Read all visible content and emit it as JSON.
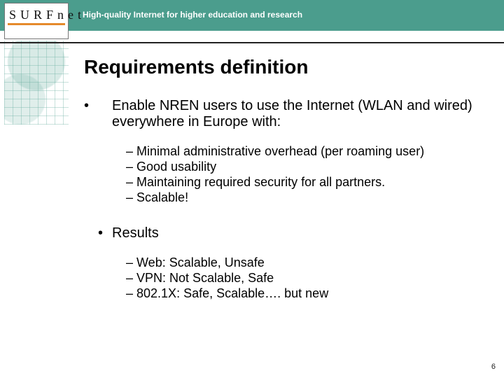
{
  "header": {
    "logo_text": "SURFnet",
    "tagline": "High-quality Internet for higher education and research"
  },
  "title": "Requirements definition",
  "bullets": [
    {
      "text": "Enable NREN users to use the Internet (WLAN and wired) everywhere in Europe with:",
      "sub": [
        "Minimal administrative overhead (per roaming user)",
        "Good usability",
        "Maintaining required security for all partners.",
        "Scalable!"
      ]
    },
    {
      "text": "Results",
      "sub": [
        "Web: Scalable, Unsafe",
        "VPN: Not Scalable, Safe",
        "802.1X: Safe, Scalable…. but new"
      ]
    }
  ],
  "page_number": "6"
}
